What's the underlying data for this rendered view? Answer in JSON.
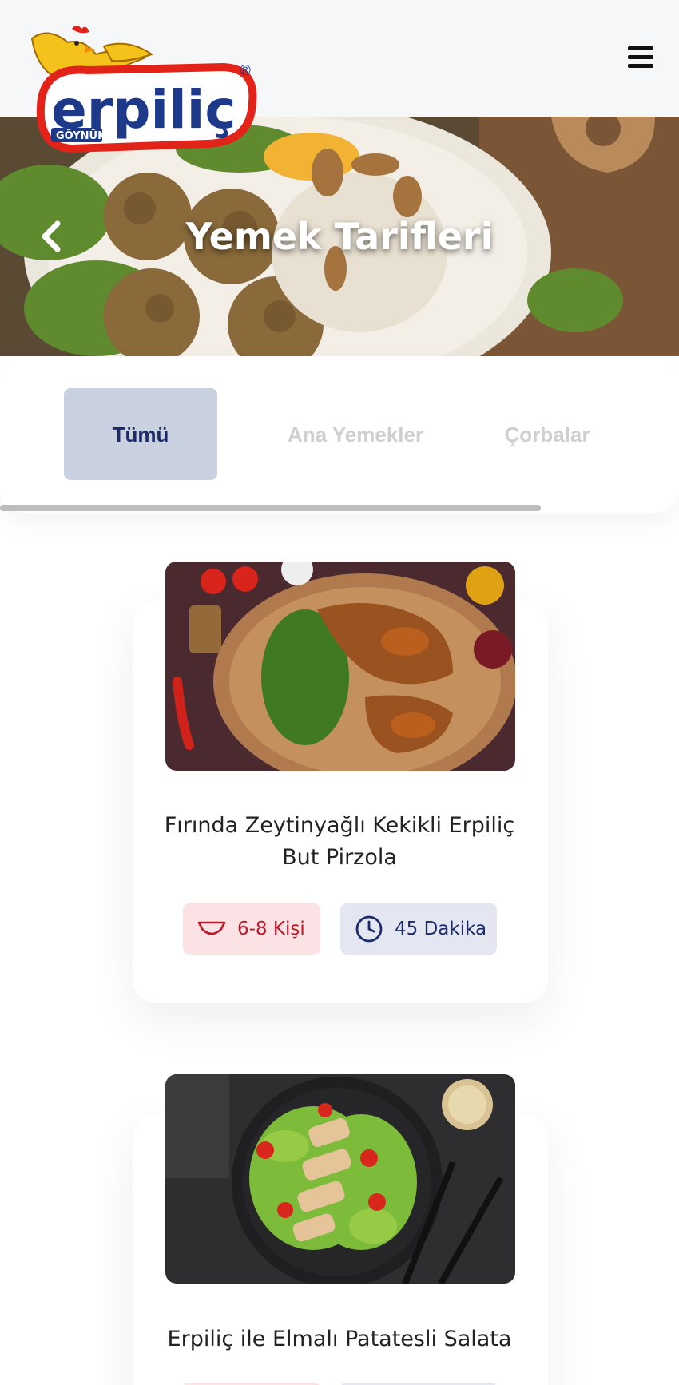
{
  "brand": {
    "name": "erpiliç",
    "sub": "GÖYNÜK",
    "registered": "®"
  },
  "hero": {
    "title": "Yemek Tarifleri"
  },
  "tabs": [
    {
      "label": "Tümü",
      "active": true
    },
    {
      "label": "Ana Yemekler",
      "active": false
    },
    {
      "label": "Çorbalar",
      "active": false
    }
  ],
  "recipes": [
    {
      "title": "Fırında Zeytinyağlı Kekikli Erpiliç But Pirzola",
      "servings": "6-8 Kişi",
      "time": "45 Dakika",
      "image": "roasted-chicken-photo"
    },
    {
      "title": "Erpiliç ile Elmalı Patatesli Salata",
      "servings": "",
      "time": "",
      "image": "chicken-salad-photo"
    }
  ],
  "colors": {
    "accent_navy": "#1b2a6b",
    "accent_red": "#c0182a",
    "tab_active_bg": "#c9d0e0"
  },
  "icons": {
    "menu": "hamburger-icon",
    "back": "chevron-left-icon",
    "servings": "bowl-icon",
    "time": "clock-icon"
  }
}
